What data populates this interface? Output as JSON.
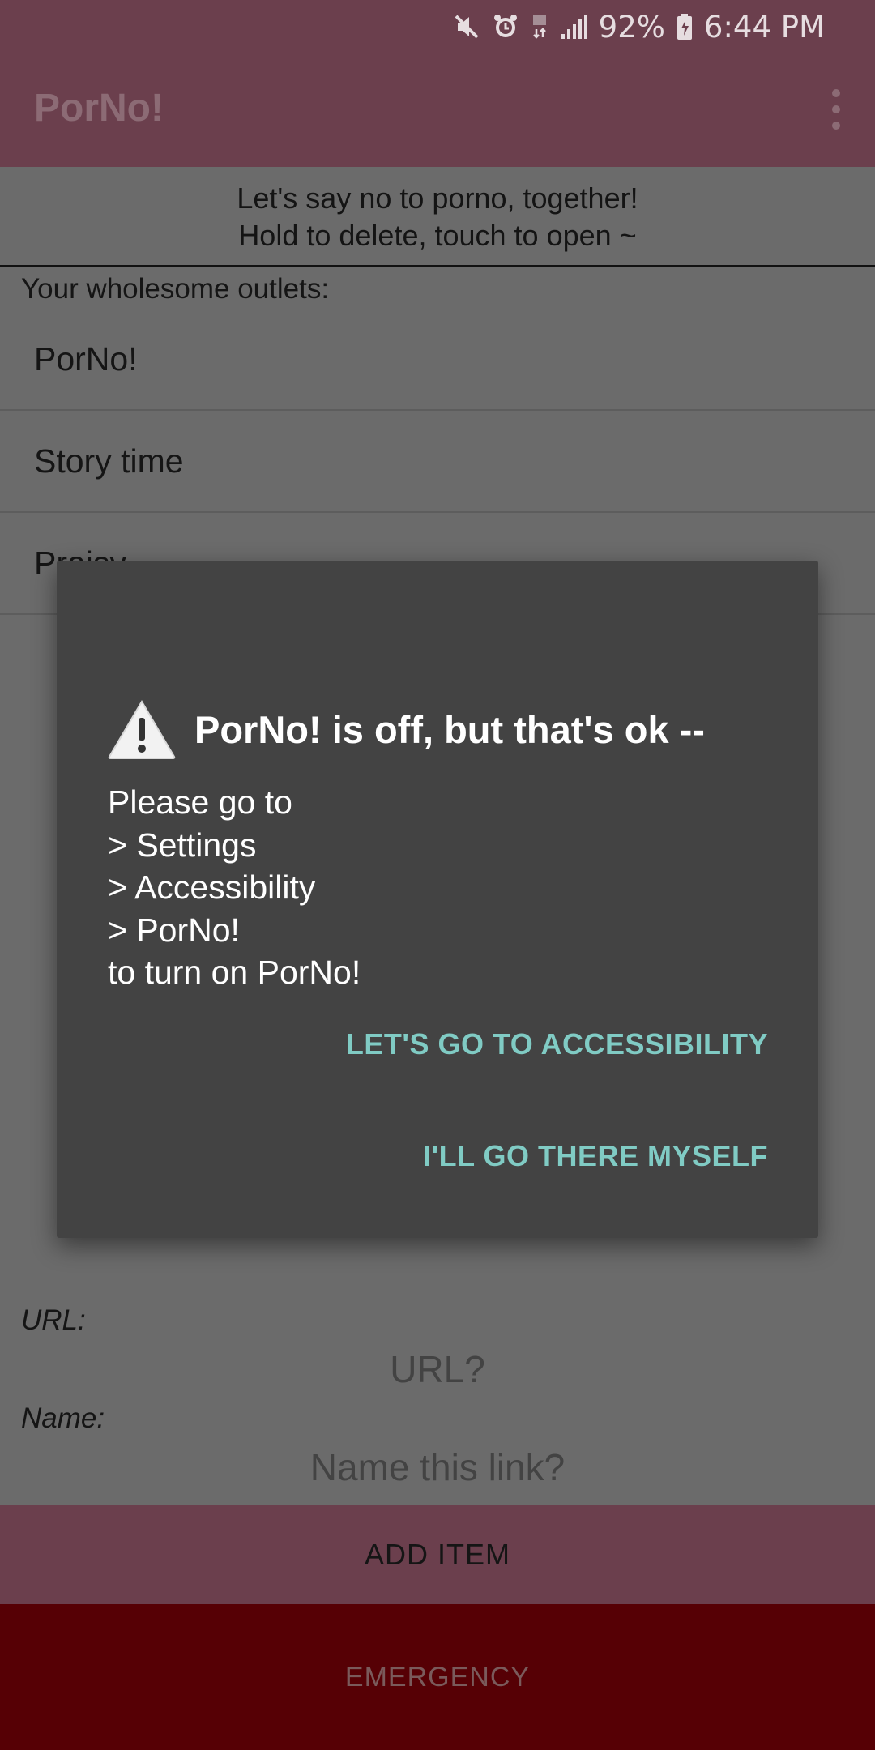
{
  "status_bar": {
    "icons": [
      "mute-icon",
      "alarm-icon",
      "data-icon",
      "signal-icon"
    ],
    "battery_percent": "92%",
    "time": "6:44 PM"
  },
  "app_bar": {
    "title": "PorNo!",
    "menu_icon": "more-vert-icon"
  },
  "header": {
    "line1": "Let's say no to porno, together!",
    "line2": "Hold to delete, touch to open ~"
  },
  "outlets": {
    "heading": "Your wholesome outlets:",
    "items": [
      {
        "label": "PorNo!"
      },
      {
        "label": "Story time"
      },
      {
        "label": "Praisy"
      }
    ]
  },
  "form": {
    "url_label": "URL:",
    "url_placeholder": "URL?",
    "name_label": "Name:",
    "name_placeholder": "Name this link?"
  },
  "buttons": {
    "add_item": "ADD ITEM",
    "emergency": "EMERGENCY"
  },
  "dialog": {
    "icon": "warning-icon",
    "title": "PorNo! is off, but that's ok --",
    "message": "Please go to\n> Settings\n> Accessibility\n> PorNo!\nto turn on PorNo!",
    "positive_button": "LET'S GO TO ACCESSIBILITY",
    "negative_button": "I'LL GO THERE MYSELF"
  },
  "colors": {
    "app_bar": "#6b3f4d",
    "emergency": "#560005",
    "dialog_bg": "#434343",
    "dialog_button": "#80cbc4"
  }
}
